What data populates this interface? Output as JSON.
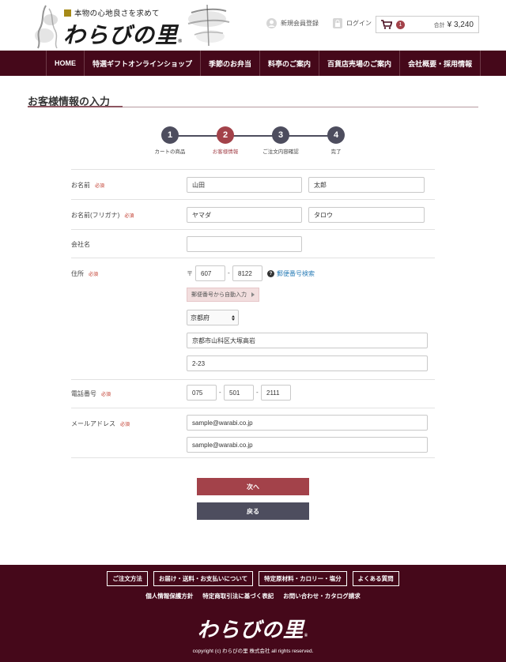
{
  "header": {
    "tagline": "本物の心地良さを求めて",
    "logo_text": "わらびの里",
    "logo_mark": "®",
    "register_label": "新規会員登録",
    "login_label": "ログイン",
    "cart_count": "1",
    "cart_total_label": "合計",
    "cart_total_value": "¥ 3,240"
  },
  "nav": {
    "items": [
      "HOME",
      "特選ギフトオンラインショップ",
      "季節のお弁当",
      "料亭のご案内",
      "百貨店売場のご案内",
      "会社概要・採用情報"
    ]
  },
  "page_title": "お客様情報の入力",
  "steps": [
    {
      "num": "1",
      "label": "カートの商品"
    },
    {
      "num": "2",
      "label": "お客様情報"
    },
    {
      "num": "3",
      "label": "ご注文内容確認"
    },
    {
      "num": "4",
      "label": "完了"
    }
  ],
  "form": {
    "required_label": "必須",
    "name_label": "お名前",
    "last_name": "山田",
    "first_name": "太郎",
    "kana_label": "お名前(フリガナ)",
    "last_kana": "ヤマダ",
    "first_kana": "タロウ",
    "company_label": "会社名",
    "company_value": "",
    "address_label": "住所",
    "zip_mark": "〒",
    "zip1": "607",
    "zip2": "8122",
    "zip_dash": "-",
    "zip_search_label": "郵便番号検索",
    "auto_fill_label": "郵便番号から自動入力",
    "prefecture": "京都府",
    "address1": "京都市山科区大塚高岩",
    "address2": "2-23",
    "phone_label": "電話番号",
    "phone1": "075",
    "phone2": "501",
    "phone3": "2111",
    "email_label": "メールアドレス",
    "email": "sample@warabi.co.jp",
    "email_confirm": "sample@warabi.co.jp"
  },
  "buttons": {
    "next": "次へ",
    "back": "戻る"
  },
  "footer": {
    "links": [
      "ご注文方法",
      "お届け・送料・お支払いについて",
      "特定原材料・カロリー・塩分",
      "よくある質問"
    ],
    "links2": [
      "個人情報保護方針",
      "特定商取引法に基づく表記",
      "お問い合わせ・カタログ請求"
    ],
    "logo_text": "わらびの里",
    "logo_mark": "®",
    "copyright": "copyright (c) わらびの里 株式会社 all rights reserved."
  },
  "colors": {
    "brand": "#45081a",
    "accent": "#a3424a",
    "step_dark": "#4d4d5e"
  }
}
